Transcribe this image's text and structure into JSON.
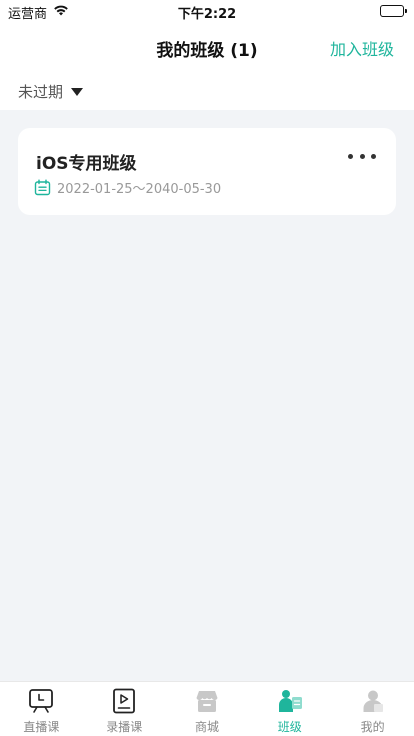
{
  "status_bar": {
    "carrier": "运营商",
    "time": "下午2:22"
  },
  "header": {
    "title": "我的班级 (1)",
    "join_label": "加入班级"
  },
  "filter": {
    "label": "未过期"
  },
  "classes": [
    {
      "name": "iOS专用班级",
      "date_range": "2022-01-25～2040-05-30"
    }
  ],
  "tabs": [
    {
      "label": "直播课",
      "icon": "live-class-icon",
      "active": false
    },
    {
      "label": "录播课",
      "icon": "recorded-class-icon",
      "active": false
    },
    {
      "label": "商城",
      "icon": "store-icon",
      "active": false
    },
    {
      "label": "班级",
      "icon": "class-icon",
      "active": true
    },
    {
      "label": "我的",
      "icon": "profile-icon",
      "active": false
    }
  ],
  "colors": {
    "accent": "#1fb59c",
    "background": "#f2f4f7"
  }
}
